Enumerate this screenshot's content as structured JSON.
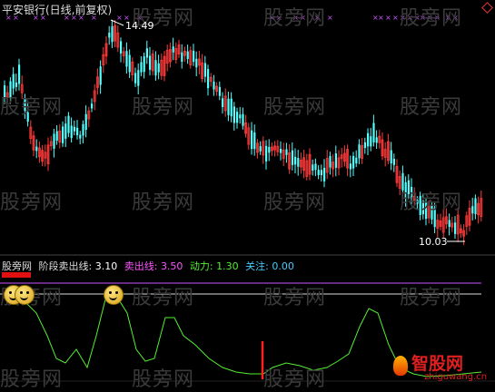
{
  "title": "平安银行(日线,前复权)",
  "high_label": "14.49",
  "low_label": "10.03",
  "watermark": "股旁网",
  "indicator": {
    "name": "股旁网",
    "param1_label": "阶段卖出线:",
    "param1_value": "3.10",
    "param2_label": "卖出线:",
    "param2_value": "3.50",
    "param3_label": "动力:",
    "param3_value": "1.30",
    "param4_label": "关注:",
    "param4_value": "0.00"
  },
  "logo": {
    "text": "智股网",
    "url": "zhiguwang.cn"
  },
  "colors": {
    "up": "#ff3a3a",
    "down": "#54ffff",
    "cross": "#cc55ff",
    "line": "#55ee33",
    "bg": "#000000"
  }
}
